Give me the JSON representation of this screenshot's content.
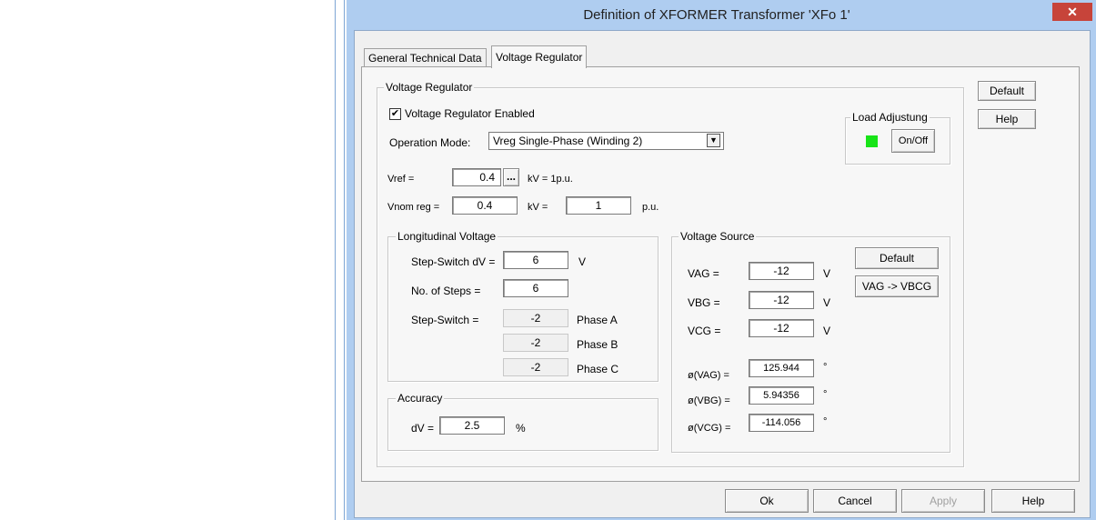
{
  "window": {
    "title": "Definition of XFORMER Transformer 'XFo 1'",
    "close_glyph": "✕"
  },
  "tabs": [
    {
      "label": "General Technical Data"
    },
    {
      "label": "Voltage Regulator"
    }
  ],
  "side_buttons": {
    "default": "Default",
    "help": "Help"
  },
  "voltage_regulator": {
    "group_label": "Voltage Regulator",
    "enabled_label": "Voltage Regulator Enabled",
    "enabled_checked": true,
    "check_glyph": "✔",
    "operation_mode_label": "Operation Mode:",
    "operation_mode_value": "Vreg Single-Phase (Winding 2)",
    "vref_label": "Vref =",
    "vref_value": "0.4",
    "vref_browse": "...",
    "vref_unit": "kV = 1p.u.",
    "vnom_label": "Vnom reg =",
    "vnom_value": "0.4",
    "vnom_unit": "kV =",
    "vnom_pu_value": "1",
    "vnom_pu_unit": "p.u."
  },
  "load_adjusting": {
    "label": "Load Adjustung",
    "button": "On/Off",
    "indicator_color": "#18e418"
  },
  "longitudinal": {
    "label": "Longitudinal Voltage",
    "step_dv_label": "Step-Switch dV =",
    "step_dv_value": "6",
    "step_dv_unit": "V",
    "steps_label": "No. of Steps =",
    "steps_value": "6",
    "switch_label": "Step-Switch =",
    "phases": [
      {
        "value": "-2",
        "label": "Phase A"
      },
      {
        "value": "-2",
        "label": "Phase B"
      },
      {
        "value": "-2",
        "label": "Phase C"
      }
    ]
  },
  "accuracy": {
    "label": "Accuracy",
    "dv_label": "dV =",
    "dv_value": "2.5",
    "dv_unit": "%"
  },
  "voltage_source": {
    "label": "Voltage Source",
    "default_button": "Default",
    "convert_button": "VAG -> VBCG",
    "rows": [
      {
        "label": "VAG =",
        "value": "-12",
        "unit": "V"
      },
      {
        "label": "VBG =",
        "value": "-12",
        "unit": "V"
      },
      {
        "label": "VCG =",
        "value": "-12",
        "unit": "V"
      }
    ],
    "angles": [
      {
        "label": "ø(VAG) =",
        "value": "125.944",
        "unit": "°"
      },
      {
        "label": "ø(VBG) =",
        "value": "5.94356",
        "unit": "°"
      },
      {
        "label": "ø(VCG) =",
        "value": "-114.056",
        "unit": "°"
      }
    ]
  },
  "footer": {
    "ok": "Ok",
    "cancel": "Cancel",
    "apply": "Apply",
    "help": "Help"
  }
}
